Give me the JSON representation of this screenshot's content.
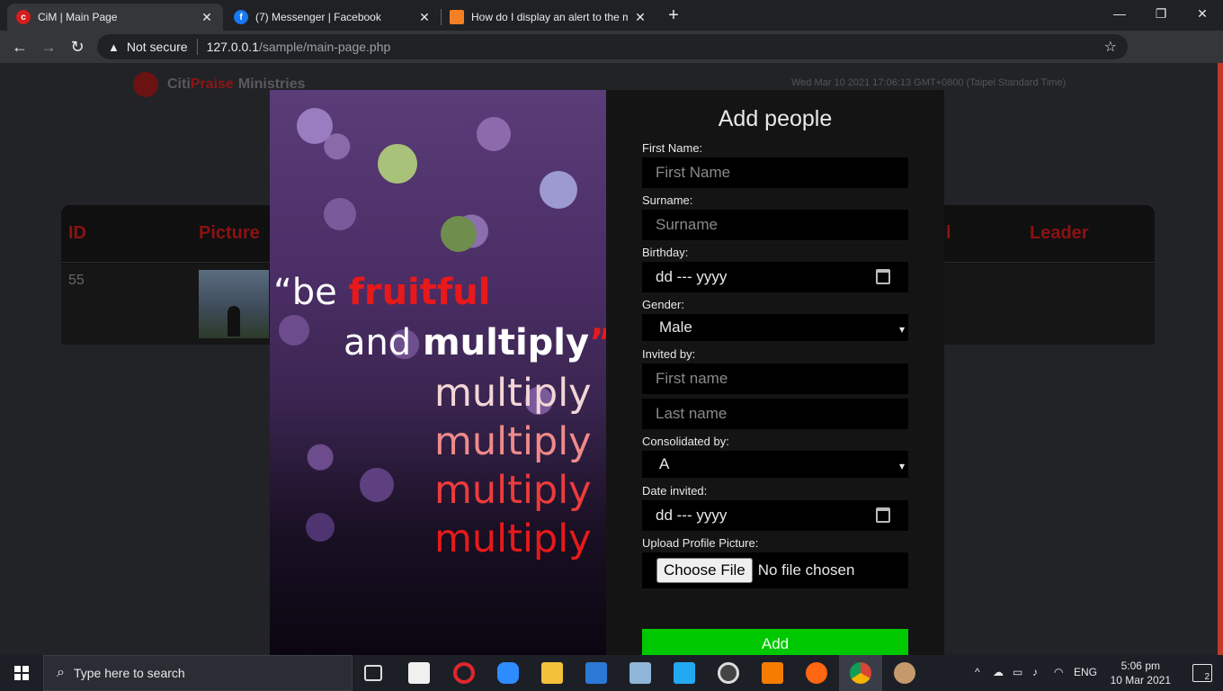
{
  "browser": {
    "tabs": [
      {
        "title": "CiM | Main Page",
        "icon": "cim-favicon"
      },
      {
        "title": "(7) Messenger | Facebook",
        "icon": "facebook-icon"
      },
      {
        "title": "How do I display an alert to the m",
        "icon": "stackoverflow-icon"
      }
    ],
    "security_label": "Not secure",
    "url_host": "127.0.0.1",
    "url_path": "/sample/main-page.php"
  },
  "page": {
    "brand_citi": "Citi",
    "brand_praise": "Praise",
    "brand_ministries": "Ministries",
    "datetime": "Wed Mar 10 2021 17:06:13 GMT+0800 (Taipei Standard Time)",
    "table": {
      "headers": {
        "id": "ID",
        "picture": "Picture",
        "leader": "Leader",
        "partial": "l"
      },
      "rows": [
        {
          "id": "55"
        }
      ]
    }
  },
  "poster": {
    "open_quote": "“",
    "be": "be ",
    "fruitful": "fruitful",
    "and": "and ",
    "multiply_bold": "multiply",
    "close_quote": "”",
    "multiply_lines": [
      "multiply",
      "multiply",
      "multiply",
      "multiply"
    ],
    "multiply_colors": [
      "#f4d6d6",
      "#f08a8a",
      "#ee3b3b",
      "#e8191a"
    ]
  },
  "form": {
    "title": "Add people",
    "first_name_label": "First Name:",
    "first_name_placeholder": "First Name",
    "surname_label": "Surname:",
    "surname_placeholder": "Surname",
    "birthday_label": "Birthday:",
    "birthday_value": "dd --- yyyy",
    "gender_label": "Gender:",
    "gender_value": "Male",
    "invited_label": "Invited by:",
    "invited_first_placeholder": "First name",
    "invited_last_placeholder": "Last name",
    "consolidated_label": "Consolidated by:",
    "consolidated_value": "A",
    "date_invited_label": "Date invited:",
    "date_invited_value": "dd --- yyyy",
    "upload_label": "Upload Profile Picture:",
    "choose_file": "Choose File",
    "no_file": "No file chosen",
    "add_button": "Add",
    "add_color": "#00c800"
  },
  "taskbar": {
    "search_placeholder": "Type here to search",
    "language": "ENG",
    "time": "5:06 pm",
    "date": "10 Mar 2021",
    "notification_count": "2"
  }
}
